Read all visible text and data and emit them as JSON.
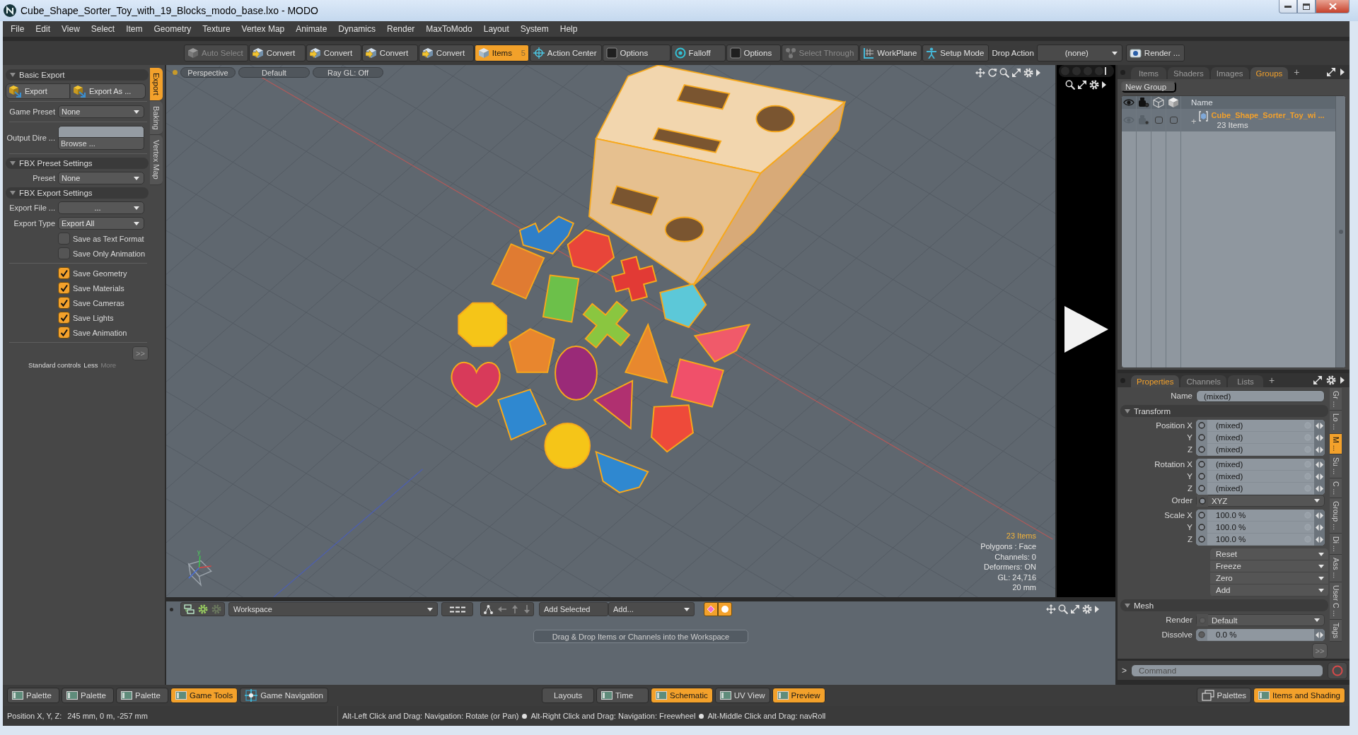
{
  "window": {
    "title": "Cube_Shape_Sorter_Toy_with_19_Blocks_modo_base.lxo - MODO"
  },
  "menu_bar": [
    "File",
    "Edit",
    "View",
    "Select",
    "Item",
    "Geometry",
    "Texture",
    "Vertex Map",
    "Animate",
    "Dynamics",
    "Render",
    "MaxToModo",
    "Layout",
    "System",
    "Help"
  ],
  "toolbar": {
    "buttons": [
      {
        "label": "Auto Select",
        "selected": false,
        "disabled": true
      },
      {
        "label": "Convert",
        "selected": false,
        "disabled": false
      },
      {
        "label": "Convert",
        "selected": false,
        "disabled": false
      },
      {
        "label": "Convert",
        "selected": false,
        "disabled": false
      },
      {
        "label": "Convert",
        "selected": false,
        "disabled": false
      },
      {
        "label": "Items",
        "selected": true,
        "disabled": false,
        "badge": "5"
      },
      {
        "label": "Action Center",
        "selected": false,
        "disabled": false
      },
      {
        "label": "Options",
        "selected": false,
        "disabled": false
      },
      {
        "label": "Falloff",
        "selected": false,
        "disabled": false
      },
      {
        "label": "Options",
        "selected": false,
        "disabled": false
      },
      {
        "label": "Select Through",
        "selected": false,
        "disabled": true
      },
      {
        "label": "WorkPlane",
        "selected": false,
        "disabled": false
      },
      {
        "label": "Setup Mode",
        "selected": false,
        "disabled": false
      }
    ],
    "drop_action": {
      "label": "Drop Action",
      "value": "(none)"
    },
    "render_button": "Render ..."
  },
  "left_panel": {
    "tabs": [
      {
        "label": "Export",
        "selected": true
      },
      {
        "label": "Baking",
        "selected": false
      },
      {
        "label": "Vertex Map",
        "selected": false
      }
    ],
    "rows": [
      {
        "kind": "header",
        "label": "Basic Export",
        "expanded": true
      },
      {
        "kind": "buttons",
        "items": [
          "Export",
          "Export As ..."
        ]
      },
      {
        "kind": "divider"
      },
      {
        "kind": "dropdown",
        "label": "Game Preset",
        "selection": "None"
      },
      {
        "kind": "divider"
      },
      {
        "kind": "file",
        "label": "Output Dire ...",
        "button": "Browse ..."
      },
      {
        "kind": "divider"
      },
      {
        "kind": "header",
        "label": "FBX Preset Settings",
        "expanded": true
      },
      {
        "kind": "dropdown",
        "label": "Preset",
        "selection": "None"
      },
      {
        "kind": "header",
        "label": "FBX Export Settings",
        "expanded": true
      },
      {
        "kind": "dropdown",
        "label": "Export File ...",
        "selection": "..."
      },
      {
        "kind": "dropdown",
        "label": "Export Type",
        "selection": "Export All"
      },
      {
        "kind": "checkbox",
        "label": "Save as Text Format",
        "checked": false
      },
      {
        "kind": "checkbox",
        "label": "Save Only Animation",
        "checked": false
      },
      {
        "kind": "divider"
      },
      {
        "kind": "checkbox",
        "label": "Save Geometry",
        "checked": true
      },
      {
        "kind": "checkbox",
        "label": "Save Materials",
        "checked": true
      },
      {
        "kind": "checkbox",
        "label": "Save Cameras",
        "checked": true
      },
      {
        "kind": "checkbox",
        "label": "Save Lights",
        "checked": true
      },
      {
        "kind": "checkbox",
        "label": "Save Animation",
        "checked": true
      },
      {
        "kind": "divider"
      }
    ],
    "more_button": ">>",
    "footer": [
      {
        "label": "Standard controls",
        "disabled": false
      },
      {
        "label": "Less",
        "disabled": false
      },
      {
        "label": "More",
        "disabled": true
      }
    ]
  },
  "viewport": {
    "buttons": [
      "Perspective",
      "Default",
      "Ray GL: Off"
    ],
    "axis_label": "y",
    "info": [
      {
        "text": "23 Items",
        "highlighted": true
      },
      {
        "text": "Polygons : Face",
        "highlighted": false
      },
      {
        "text": "Channels: 0",
        "highlighted": false
      },
      {
        "text": "Deformers: ON",
        "highlighted": false
      },
      {
        "text": "GL: 24,716",
        "highlighted": false
      },
      {
        "text": "20 mm",
        "highlighted": false
      }
    ]
  },
  "workspace": {
    "dropdown": "Workspace",
    "add_selected": "Add Selected",
    "add_menu": "Add...",
    "hint": "Drag & Drop Items or Channels into the Workspace"
  },
  "groups_panel": {
    "tabs": [
      {
        "label": "Items",
        "selected": false
      },
      {
        "label": "Shaders",
        "selected": false
      },
      {
        "label": "Images",
        "selected": false
      },
      {
        "label": "Groups",
        "selected": true
      }
    ],
    "add_tab": "+",
    "new_group": "New Group",
    "name_column": "Name",
    "rows": [
      {
        "expander": "+",
        "name": "Cube_Shape_Sorter_Toy_wi ...",
        "count": "23 Items",
        "selected": true
      }
    ]
  },
  "properties_panel": {
    "tabs": [
      {
        "label": "Properties",
        "selected": true
      },
      {
        "label": "Channels",
        "selected": false
      },
      {
        "label": "Lists",
        "selected": false
      }
    ],
    "add_tab": "+",
    "rows": [
      {
        "kind": "text",
        "label": "Name",
        "value": "(mixed)"
      },
      {
        "kind": "header",
        "label": "Transform",
        "expanded": true
      },
      {
        "kind": "vector",
        "fields": [
          {
            "label": "Position X",
            "value": "(mixed)"
          },
          {
            "label": "Y",
            "value": "(mixed)"
          },
          {
            "label": "Z",
            "value": "(mixed)"
          }
        ]
      },
      {
        "kind": "vector",
        "fields": [
          {
            "label": "Rotation X",
            "value": "(mixed)"
          },
          {
            "label": "Y",
            "value": "(mixed)"
          },
          {
            "label": "Z",
            "value": "(mixed)"
          }
        ]
      },
      {
        "kind": "choice",
        "label": "Order",
        "value": "XYZ",
        "channel_enabled": true
      },
      {
        "kind": "vector",
        "fields": [
          {
            "label": "Scale X",
            "value": "100.0 %"
          },
          {
            "label": "Y",
            "value": "100.0 %"
          },
          {
            "label": "Z",
            "value": "100.0 %"
          }
        ]
      },
      {
        "kind": "menus",
        "items": [
          "Reset",
          "Freeze",
          "Zero",
          "Add"
        ]
      },
      {
        "kind": "header",
        "label": "Mesh",
        "expanded": true
      },
      {
        "kind": "choice",
        "label": "Render",
        "value": "Default",
        "channel_enabled": false
      },
      {
        "kind": "number",
        "label": "Dissolve",
        "value": "0.0 %",
        "channel_enabled": false
      }
    ],
    "more_button": ">>",
    "side_tabs": [
      {
        "label": "Gr ...",
        "selected": false
      },
      {
        "label": "Lo ...",
        "selected": false
      },
      {
        "label": "M ...",
        "selected": true
      },
      {
        "label": "Su ...",
        "selected": false
      },
      {
        "label": "C ...",
        "selected": false
      },
      {
        "label": "Group ...",
        "selected": false
      },
      {
        "label": "Di ...",
        "selected": false
      },
      {
        "label": "Ass ...",
        "selected": false
      },
      {
        "label": "User C ...",
        "selected": false
      },
      {
        "label": "Tags",
        "selected": false
      }
    ]
  },
  "command": {
    "prompt": ">",
    "placeholder": "Command"
  },
  "layout_bar": {
    "left": [
      {
        "kind": "panel",
        "label": "Palette",
        "selected": false
      },
      {
        "kind": "panel",
        "label": "Palette",
        "selected": false
      },
      {
        "kind": "panel",
        "label": "Palette",
        "selected": false
      },
      {
        "kind": "panel",
        "label": "Game Tools",
        "selected": true
      },
      {
        "kind": "navigation",
        "label": "Game Navigation",
        "selected": false
      }
    ],
    "center": [
      {
        "kind": "plain",
        "label": "Layouts",
        "selected": false
      },
      {
        "kind": "panel",
        "label": "Time",
        "selected": false
      },
      {
        "kind": "panel",
        "label": "Schematic",
        "selected": true
      },
      {
        "kind": "panel",
        "label": "UV View",
        "selected": false
      },
      {
        "kind": "panel",
        "label": "Preview",
        "selected": true
      }
    ],
    "right": [
      {
        "kind": "palettes",
        "label": "Palettes",
        "selected": false
      },
      {
        "kind": "panel",
        "label": "Items and Shading",
        "selected": true
      }
    ]
  },
  "status_bar": {
    "position_label": "Position X, Y, Z:",
    "position_value": "245 mm, 0 m, -257 mm",
    "hints": [
      "Alt-Left Click and Drag: Navigation: Rotate (or Pan)",
      "Alt-Right Click and Drag: Navigation: Freewheel",
      "Alt-Middle Click and Drag: navRoll"
    ]
  }
}
